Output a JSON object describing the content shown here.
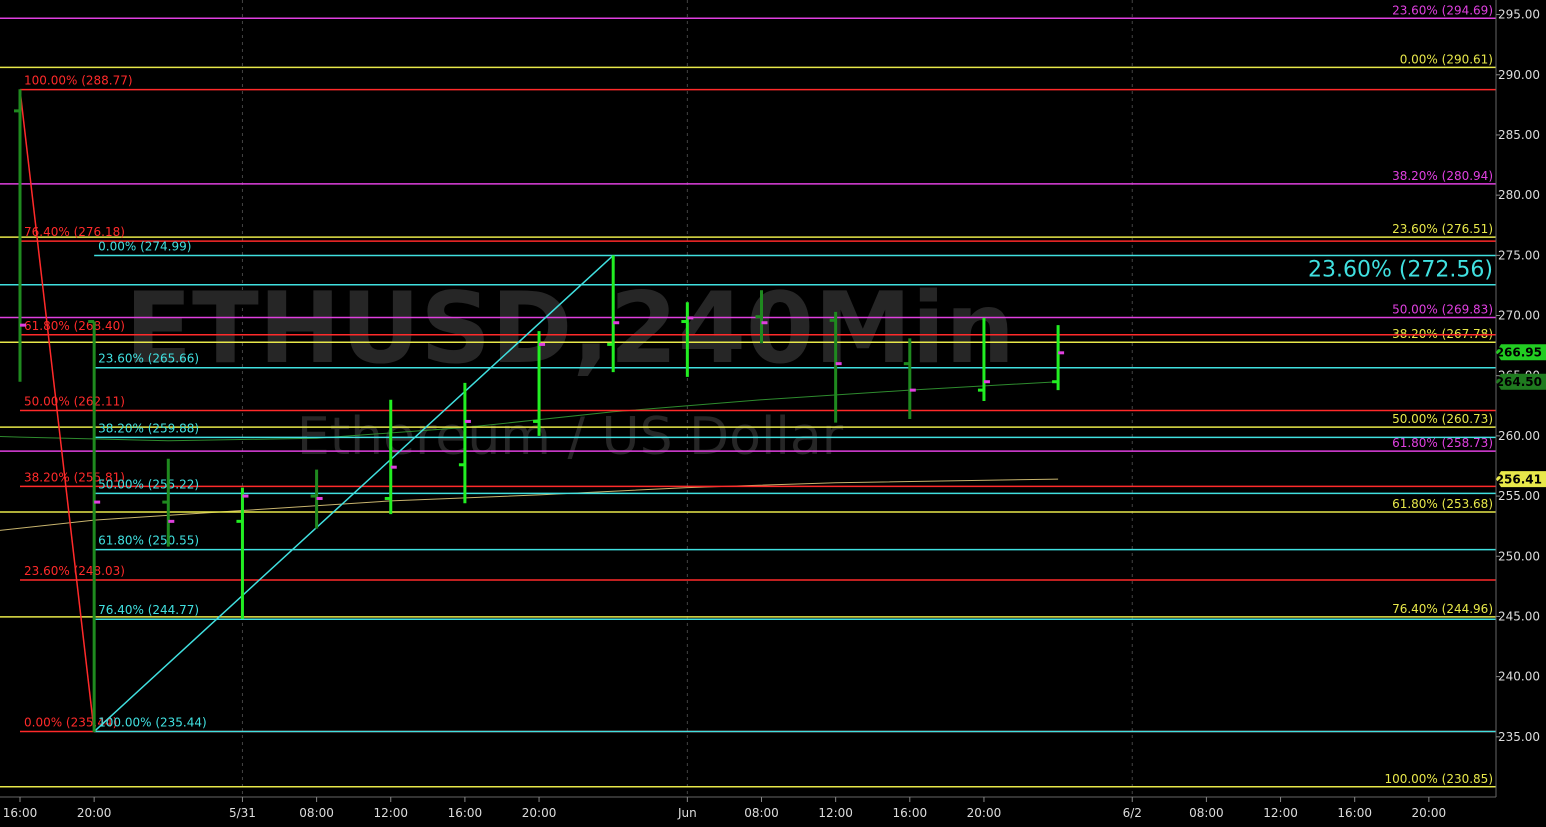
{
  "chart_data": {
    "type": "bar",
    "watermark": {
      "symbol": "ETHUSD,240Min",
      "name": "Ethereum / US Dollar"
    },
    "ylim": [
      230,
      297
    ],
    "y_ticks": [
      235,
      240,
      245,
      250,
      255,
      260,
      265,
      270,
      275,
      280,
      285,
      290,
      295
    ],
    "x_ticks": [
      {
        "label": "16:00",
        "bar": 0
      },
      {
        "label": "20:00",
        "bar": 1
      },
      {
        "label": "5/31",
        "bar": 3
      },
      {
        "label": "08:00",
        "bar": 4
      },
      {
        "label": "12:00",
        "bar": 5
      },
      {
        "label": "16:00",
        "bar": 6
      },
      {
        "label": "20:00",
        "bar": 7
      },
      {
        "label": "Jun",
        "bar": 9
      },
      {
        "label": "08:00",
        "bar": 10
      },
      {
        "label": "12:00",
        "bar": 11
      },
      {
        "label": "16:00",
        "bar": 12
      },
      {
        "label": "20:00",
        "bar": 13
      },
      {
        "label": "6/2",
        "bar": 15
      },
      {
        "label": "08:00",
        "bar": 16
      },
      {
        "label": "12:00",
        "bar": 17
      },
      {
        "label": "16:00",
        "bar": 18
      },
      {
        "label": "20:00",
        "bar": 19
      }
    ],
    "x_dividers": [
      3,
      9,
      15
    ],
    "bars": [
      {
        "o": 287.0,
        "h": 288.8,
        "l": 264.5,
        "c": 269.2
      },
      {
        "o": 269.5,
        "h": 269.5,
        "l": 235.4,
        "c": 254.5
      },
      {
        "o": 254.5,
        "h": 258.1,
        "l": 250.8,
        "c": 252.9
      },
      {
        "o": 252.9,
        "h": 255.7,
        "l": 244.8,
        "c": 255.0
      },
      {
        "o": 255.0,
        "h": 257.2,
        "l": 252.3,
        "c": 254.8
      },
      {
        "o": 254.8,
        "h": 263.0,
        "l": 253.5,
        "c": 257.4
      },
      {
        "o": 257.6,
        "h": 264.4,
        "l": 254.4,
        "c": 261.2
      },
      {
        "o": 261.2,
        "h": 268.7,
        "l": 260.0,
        "c": 267.6
      },
      {
        "o": 267.6,
        "h": 275.0,
        "l": 265.3,
        "c": 269.4
      },
      {
        "o": 269.5,
        "h": 271.1,
        "l": 264.9,
        "c": 269.8
      },
      {
        "o": 269.9,
        "h": 272.1,
        "l": 267.7,
        "c": 269.4
      },
      {
        "o": 269.6,
        "h": 270.3,
        "l": 261.1,
        "c": 266.0
      },
      {
        "o": 266.0,
        "h": 268.1,
        "l": 261.4,
        "c": 263.8
      },
      {
        "o": 263.8,
        "h": 269.8,
        "l": 262.9,
        "c": 264.5
      },
      {
        "o": 264.5,
        "h": 269.2,
        "l": 263.8,
        "c": 266.9
      }
    ],
    "moving_averages": [
      {
        "color": "#2e8b2e",
        "points": [
          [
            -0.5,
            260.0
          ],
          [
            0,
            259.9
          ],
          [
            2,
            259.6
          ],
          [
            4,
            259.8
          ],
          [
            6,
            260.7
          ],
          [
            8,
            262.0
          ],
          [
            10,
            263.0
          ],
          [
            12,
            263.8
          ],
          [
            14,
            264.5
          ]
        ]
      },
      {
        "color": "#c8b46e",
        "points": [
          [
            -0.5,
            252.0
          ],
          [
            1,
            253.0
          ],
          [
            3,
            253.8
          ],
          [
            5,
            254.6
          ],
          [
            7,
            255.1
          ],
          [
            9,
            255.7
          ],
          [
            11,
            256.1
          ],
          [
            14,
            256.41
          ]
        ]
      }
    ],
    "price_tags": [
      {
        "label": "266.95",
        "value": 266.95,
        "bg": "#22cc22",
        "fg": "#000000"
      },
      {
        "label": "264.50",
        "value": 264.5,
        "bg": "#1f7a1f",
        "fg": "#000000"
      },
      {
        "label": "256.41",
        "value": 256.41,
        "bg": "#e8e84a",
        "fg": "#000000"
      }
    ],
    "swing_lines": [
      {
        "color": "#ff2a2a",
        "from": [
          0,
          288.77
        ],
        "to": [
          1,
          235.44
        ]
      },
      {
        "color": "#40e0e0",
        "from": [
          1,
          235.44
        ],
        "to": [
          8,
          274.99
        ]
      }
    ],
    "fib_levels": [
      {
        "color": "#e040e0",
        "value": 294.69,
        "label": "23.60% (294.69)",
        "start": -0.5,
        "label_side": "right"
      },
      {
        "color": "#e8e84a",
        "value": 290.61,
        "label": "0.00% (290.61)",
        "start": -0.5,
        "label_side": "right"
      },
      {
        "color": "#e040e0",
        "value": 280.94,
        "label": "38.20% (280.94)",
        "start": -0.5,
        "label_side": "right"
      },
      {
        "color": "#e8e84a",
        "value": 276.51,
        "label": "23.60% (276.51)",
        "start": -0.5,
        "label_side": "right"
      },
      {
        "color": "#40e0e0",
        "value": 272.56,
        "label": "23.60% (272.56)",
        "start": -0.5,
        "label_side": "right",
        "big": true
      },
      {
        "color": "#e040e0",
        "value": 269.83,
        "label": "50.00% (269.83)",
        "start": -0.5,
        "label_side": "right"
      },
      {
        "color": "#e8e84a",
        "value": 267.78,
        "label": "38.20% (267.78)",
        "start": -0.5,
        "label_side": "right"
      },
      {
        "color": "#e8e84a",
        "value": 260.73,
        "label": "50.00% (260.73)",
        "start": -0.5,
        "label_side": "right"
      },
      {
        "color": "#e040e0",
        "value": 258.73,
        "label": "61.80% (258.73)",
        "start": -0.5,
        "label_side": "right"
      },
      {
        "color": "#e8e84a",
        "value": 253.68,
        "label": "61.80% (253.68)",
        "start": -0.5,
        "label_side": "right"
      },
      {
        "color": "#e8e84a",
        "value": 244.96,
        "label": "76.40% (244.96)",
        "start": -0.5,
        "label_side": "right"
      },
      {
        "color": "#e8e84a",
        "value": 230.85,
        "label": "100.00% (230.85)",
        "start": -0.5,
        "label_side": "right"
      },
      {
        "color": "#ff2a2a",
        "value": 288.77,
        "label": "100.00% (288.77)",
        "start": 0,
        "label_side": "left"
      },
      {
        "color": "#ff2a2a",
        "value": 276.18,
        "label": "76.40% (276.18)",
        "start": 0,
        "label_side": "left"
      },
      {
        "color": "#ff2a2a",
        "value": 268.4,
        "label": "61.80% (268.40)",
        "start": 0,
        "label_side": "left"
      },
      {
        "color": "#ff2a2a",
        "value": 262.11,
        "label": "50.00% (262.11)",
        "start": 0,
        "label_side": "left"
      },
      {
        "color": "#ff2a2a",
        "value": 255.81,
        "label": "38.20% (255.81)",
        "start": 0,
        "label_side": "left"
      },
      {
        "color": "#ff2a2a",
        "value": 248.03,
        "label": "23.60% (248.03)",
        "start": 0,
        "label_side": "left"
      },
      {
        "color": "#ff2a2a",
        "value": 235.44,
        "label": "0.00% (235.44)",
        "start": 0,
        "label_side": "left"
      },
      {
        "color": "#40e0e0",
        "value": 274.99,
        "label": "0.00% (274.99)",
        "start": 1,
        "label_side": "left"
      },
      {
        "color": "#40e0e0",
        "value": 265.66,
        "label": "23.60% (265.66)",
        "start": 1,
        "label_side": "left"
      },
      {
        "color": "#40e0e0",
        "value": 259.88,
        "label": "38.20% (259.88)",
        "start": 1,
        "label_side": "left"
      },
      {
        "color": "#40e0e0",
        "value": 255.22,
        "label": "50.00% (255.22)",
        "start": 1,
        "label_side": "left"
      },
      {
        "color": "#40e0e0",
        "value": 250.55,
        "label": "61.80% (250.55)",
        "start": 1,
        "label_side": "left"
      },
      {
        "color": "#40e0e0",
        "value": 244.77,
        "label": "76.40% (244.77)",
        "start": 1,
        "label_side": "left"
      },
      {
        "color": "#40e0e0",
        "value": 235.44,
        "label": "100.00% (235.44)",
        "start": 1,
        "label_side": "left"
      }
    ]
  }
}
